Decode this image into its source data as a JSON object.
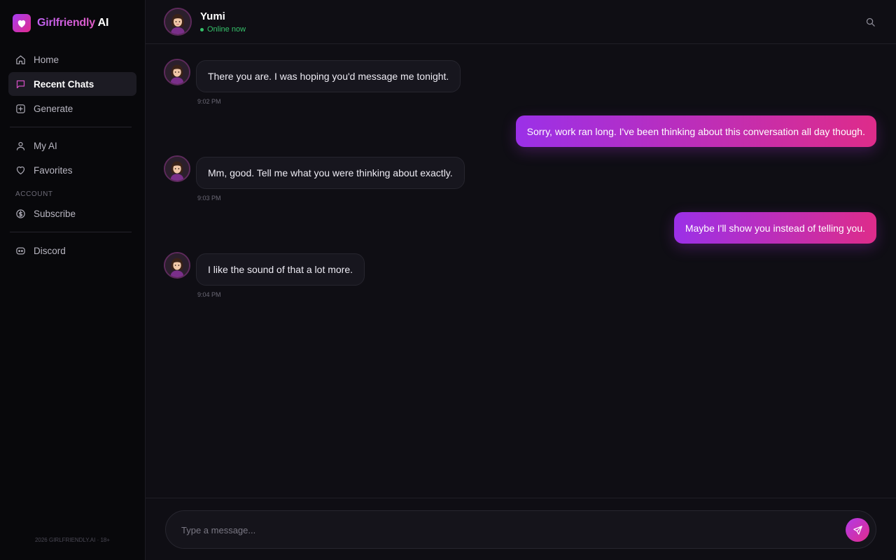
{
  "brand": {
    "name_primary": "Girlfriendly",
    "name_secondary": "AI",
    "logo_icon": "heart-icon"
  },
  "sidebar": {
    "nav": [
      {
        "label": "Home",
        "icon": "home-icon",
        "active": false
      },
      {
        "label": "Recent Chats",
        "icon": "chat-bubble-icon",
        "active": true
      },
      {
        "label": "Generate",
        "icon": "plus-square-icon",
        "active": false
      }
    ],
    "nav2": [
      {
        "label": "My AI",
        "icon": "user-icon"
      },
      {
        "label": "Favorites",
        "icon": "heart-outline-icon"
      }
    ],
    "account_label": "ACCOUNT",
    "account": [
      {
        "label": "Subscribe",
        "icon": "dollar-circle-icon"
      }
    ],
    "extra": [
      {
        "label": "Discord",
        "icon": "discord-icon"
      }
    ],
    "footer": "2026 GIRLFRIENDLY.AI · 18+"
  },
  "chat": {
    "contact_name": "Yumi",
    "status": "Online now",
    "messages": [
      {
        "from": "ai",
        "text": "There you are. I was hoping you'd message me tonight.",
        "time": "9:02 PM"
      },
      {
        "from": "user",
        "text": "Sorry, work ran long. I've been thinking about this conversation all day though."
      },
      {
        "from": "ai",
        "text": "Mm, good. Tell me what you were thinking about exactly.",
        "time": "9:03 PM"
      },
      {
        "from": "user",
        "text": "Maybe I'll show you instead of telling you."
      },
      {
        "from": "ai",
        "text": "I like the sound of that a lot more.",
        "time": "9:04 PM"
      }
    ]
  },
  "composer": {
    "placeholder": "Type a message..."
  },
  "colors": {
    "accent_start": "#9b30e8",
    "accent_end": "#de2c8a",
    "online": "#35c06a",
    "background": "#0f0e14",
    "sidebar": "#08080b"
  }
}
